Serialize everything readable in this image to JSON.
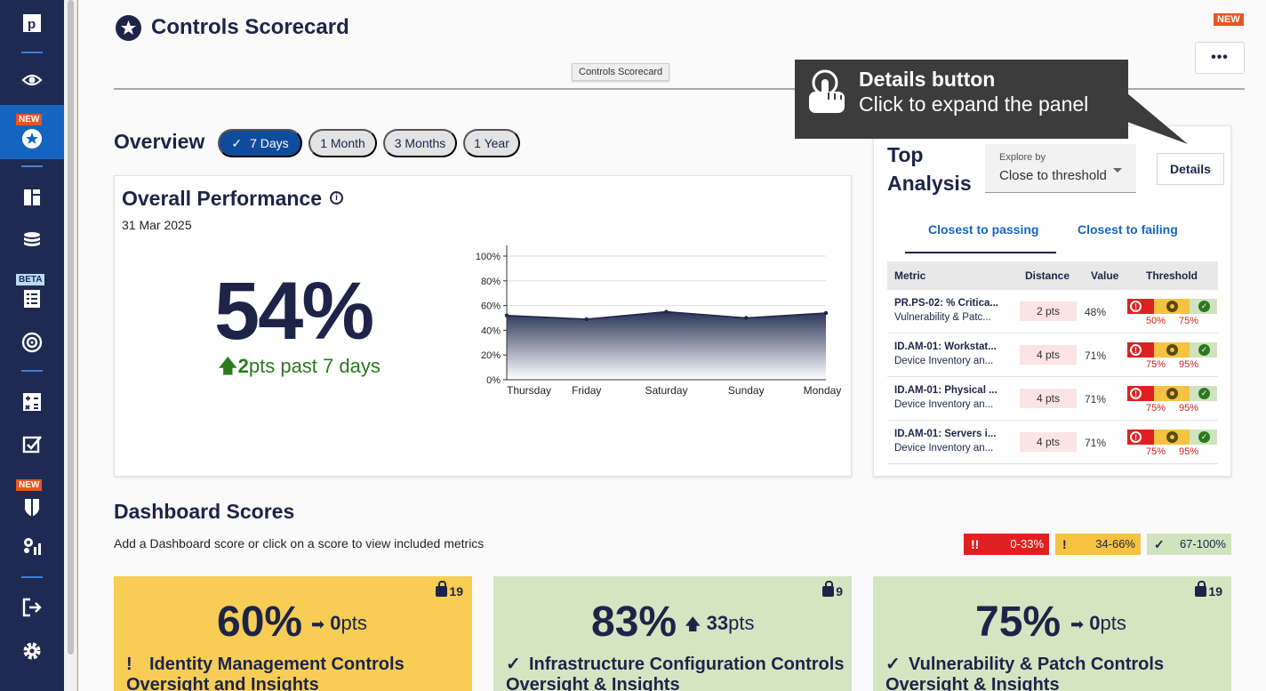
{
  "sidebar": {
    "items": [
      {
        "name": "logo",
        "icon": "logo-icon"
      },
      {
        "name": "view",
        "icon": "eye-icon"
      },
      {
        "name": "scorecard",
        "icon": "star-icon",
        "badge": "NEW",
        "active": true
      },
      {
        "name": "dashboards",
        "icon": "layout-icon"
      },
      {
        "name": "data",
        "icon": "database-icon"
      },
      {
        "name": "checklist",
        "icon": "checklist-icon",
        "badge": "BETA"
      },
      {
        "name": "target",
        "icon": "target-icon"
      },
      {
        "name": "calculator",
        "icon": "calculator-icon"
      },
      {
        "name": "tasks",
        "icon": "checkbox-icon"
      },
      {
        "name": "shield",
        "icon": "shield-icon",
        "badge": "NEW"
      },
      {
        "name": "settings-chart",
        "icon": "gears-chart-icon"
      },
      {
        "name": "logout",
        "icon": "logout-icon"
      },
      {
        "name": "settings",
        "icon": "gear-icon"
      }
    ]
  },
  "header": {
    "title": "Controls Scorecard",
    "new_badge": "NEW",
    "more_label": "•••",
    "tooltip": "Controls Scorecard"
  },
  "overview": {
    "label": "Overview",
    "periods": [
      {
        "label": "7 Days",
        "active": true
      },
      {
        "label": "1 Month",
        "active": false
      },
      {
        "label": "3 Months",
        "active": false
      },
      {
        "label": "1 Year",
        "active": false
      }
    ]
  },
  "performance": {
    "title": "Overall Performance",
    "info_icon": "i",
    "date": "31 Mar 2025",
    "value": "54%",
    "delta_value": "2",
    "delta_text": "pts past 7 days"
  },
  "chart_data": {
    "type": "area",
    "x": [
      "Thursday",
      "Friday",
      "Saturday",
      "Sunday",
      "Monday"
    ],
    "series": [
      {
        "values": [
          52,
          49,
          55,
          50,
          54
        ]
      }
    ],
    "ylim": [
      0,
      100
    ],
    "yticks": [
      "0%",
      "20%",
      "40%",
      "60%",
      "80%",
      "100%"
    ],
    "grid": true
  },
  "top_analysis": {
    "title": "Top Analysis",
    "explore_label": "Explore by",
    "explore_value": "Close to threshold",
    "details_label": "Details",
    "tabs": [
      "Closest to passing",
      "Closest to failing"
    ],
    "columns": [
      "Metric",
      "Distance",
      "Value",
      "Threshold"
    ],
    "rows": [
      {
        "metric": "PR.PS-02: % Critica...",
        "sub": "Vulnerability & Patc...",
        "distance": "2 pts",
        "value": "48%",
        "t1": "50%",
        "t2": "75%"
      },
      {
        "metric": "ID.AM-01: Workstat...",
        "sub": "Device Inventory an...",
        "distance": "4 pts",
        "value": "71%",
        "t1": "75%",
        "t2": "95%"
      },
      {
        "metric": "ID.AM-01: Physical ...",
        "sub": "Device Inventory an...",
        "distance": "4 pts",
        "value": "71%",
        "t1": "75%",
        "t2": "95%"
      },
      {
        "metric": "ID.AM-01: Servers i...",
        "sub": "Device Inventory an...",
        "distance": "4 pts",
        "value": "71%",
        "t1": "75%",
        "t2": "95%"
      }
    ]
  },
  "tip": {
    "title": "Details button",
    "body": "Click to expand the panel"
  },
  "dashboard_scores": {
    "title": "Dashboard Scores",
    "subtitle": "Add a Dashboard score or click on a score to view included metrics",
    "legend": [
      {
        "icon": "!!",
        "range": "0-33%",
        "color": "#e02020"
      },
      {
        "icon": "!",
        "range": "34-66%",
        "color": "#f5c242"
      },
      {
        "icon": "✓",
        "range": "67-100%",
        "color": "#cfe3bf"
      }
    ],
    "cards": [
      {
        "count": "19",
        "pct": "60%",
        "delta_value": "0",
        "delta_unit": "pts",
        "delta_dir": "right",
        "marker": "!",
        "name": "Identity Management Controls Oversight and Insights",
        "color": "#f8cd55"
      },
      {
        "count": "9",
        "pct": "83%",
        "delta_value": "33",
        "delta_unit": "pts",
        "delta_dir": "up",
        "marker": "✓",
        "name": "Infrastructure Configuration Controls Oversight & Insights",
        "color": "#d2e6c2"
      },
      {
        "count": "19",
        "pct": "75%",
        "delta_value": "0",
        "delta_unit": "pts",
        "delta_dir": "right",
        "marker": "✓",
        "name": "Vulnerability & Patch Controls Oversight & Insights",
        "color": "#d2e6c2"
      }
    ]
  }
}
